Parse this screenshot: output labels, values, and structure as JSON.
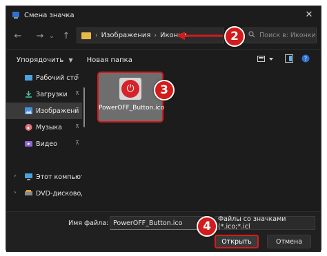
{
  "window": {
    "title": "Смена значка",
    "close_symbol": "✕"
  },
  "nav": {
    "back_symbol": "←",
    "forward_symbol": "→",
    "history_symbol": "⌄",
    "up_symbol": "↑",
    "breadcrumbs": [
      "Изображения",
      "Иконки"
    ],
    "refresh_symbol": "⟳",
    "search_placeholder": "Поиск в: Иконки"
  },
  "toolbar": {
    "organize_label": "Упорядочить",
    "new_folder_label": "Новая папка"
  },
  "sidebar": {
    "items": [
      {
        "label": "Рабочий сто",
        "icon": "desktop-icon",
        "pinned": true
      },
      {
        "label": "Загрузки",
        "icon": "download-icon",
        "pinned": true
      },
      {
        "label": "Изображени",
        "icon": "pictures-icon",
        "pinned": true
      },
      {
        "label": "Музыка",
        "icon": "music-icon",
        "pinned": true
      },
      {
        "label": "Видео",
        "icon": "video-icon",
        "pinned": true
      },
      {
        "label": "Этот компьюте",
        "icon": "computer-icon",
        "expandable": true
      },
      {
        "label": "DVD-дисковод",
        "icon": "dvd-icon",
        "expandable": true
      }
    ],
    "pin_symbol": "📌"
  },
  "files": [
    {
      "name": "PowerOFF_Button.ico",
      "icon": "power-icon",
      "selected": true
    }
  ],
  "footer": {
    "filename_label": "Имя файла:",
    "filename_value": "PowerOFF_Button.ico",
    "filetype_value": "Файлы со значками (*.ico;*.icl",
    "open_label": "Открыть",
    "cancel_label": "Отмена"
  },
  "callouts": [
    "2",
    "3",
    "4"
  ],
  "colors": {
    "accent_red": "#d41b1b",
    "folder_yellow": "#e8b84a",
    "window_bg": "#1c1c1c"
  }
}
